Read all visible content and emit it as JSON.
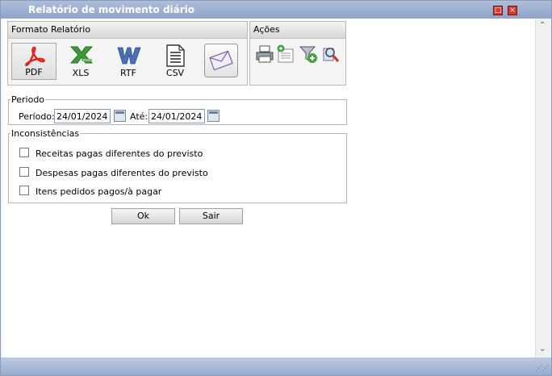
{
  "window": {
    "title": "Relatório de movimento diário",
    "maximize_icon": "maximize-icon",
    "close_icon": "close-icon"
  },
  "formato": {
    "header": "Formato Relatório",
    "buttons": [
      {
        "label": "PDF",
        "icon": "pdf-icon",
        "selected": true
      },
      {
        "label": "XLS",
        "icon": "xls-icon",
        "selected": false
      },
      {
        "label": "RTF",
        "icon": "rtf-icon",
        "selected": false
      },
      {
        "label": "CSV",
        "icon": "csv-icon",
        "selected": false
      }
    ],
    "email_icon": "envelope-icon"
  },
  "acoes": {
    "header": "Ações",
    "icons": [
      "printer-icon",
      "export-document-icon",
      "add-filter-icon",
      "search-zoom-icon"
    ]
  },
  "periodo": {
    "legend": "Periodo",
    "from_label": "Período:",
    "from_value": "24/01/2024",
    "to_label": "Até:",
    "to_value": "24/01/2024"
  },
  "inconsistencias": {
    "legend": "Inconsistências",
    "options": [
      {
        "label": "Receitas pagas diferentes do previsto",
        "checked": false
      },
      {
        "label": "Despesas pagas diferentes do previsto",
        "checked": false
      },
      {
        "label": "Itens pedidos pagos/à pagar",
        "checked": false
      }
    ]
  },
  "actions": {
    "ok": "Ok",
    "sair": "Sair"
  },
  "colors": {
    "titlebar": "#9aaed0",
    "pdf_red": "#e0231a",
    "xls_green": "#3e9a3a",
    "rtf_blue": "#4a6fb5"
  }
}
